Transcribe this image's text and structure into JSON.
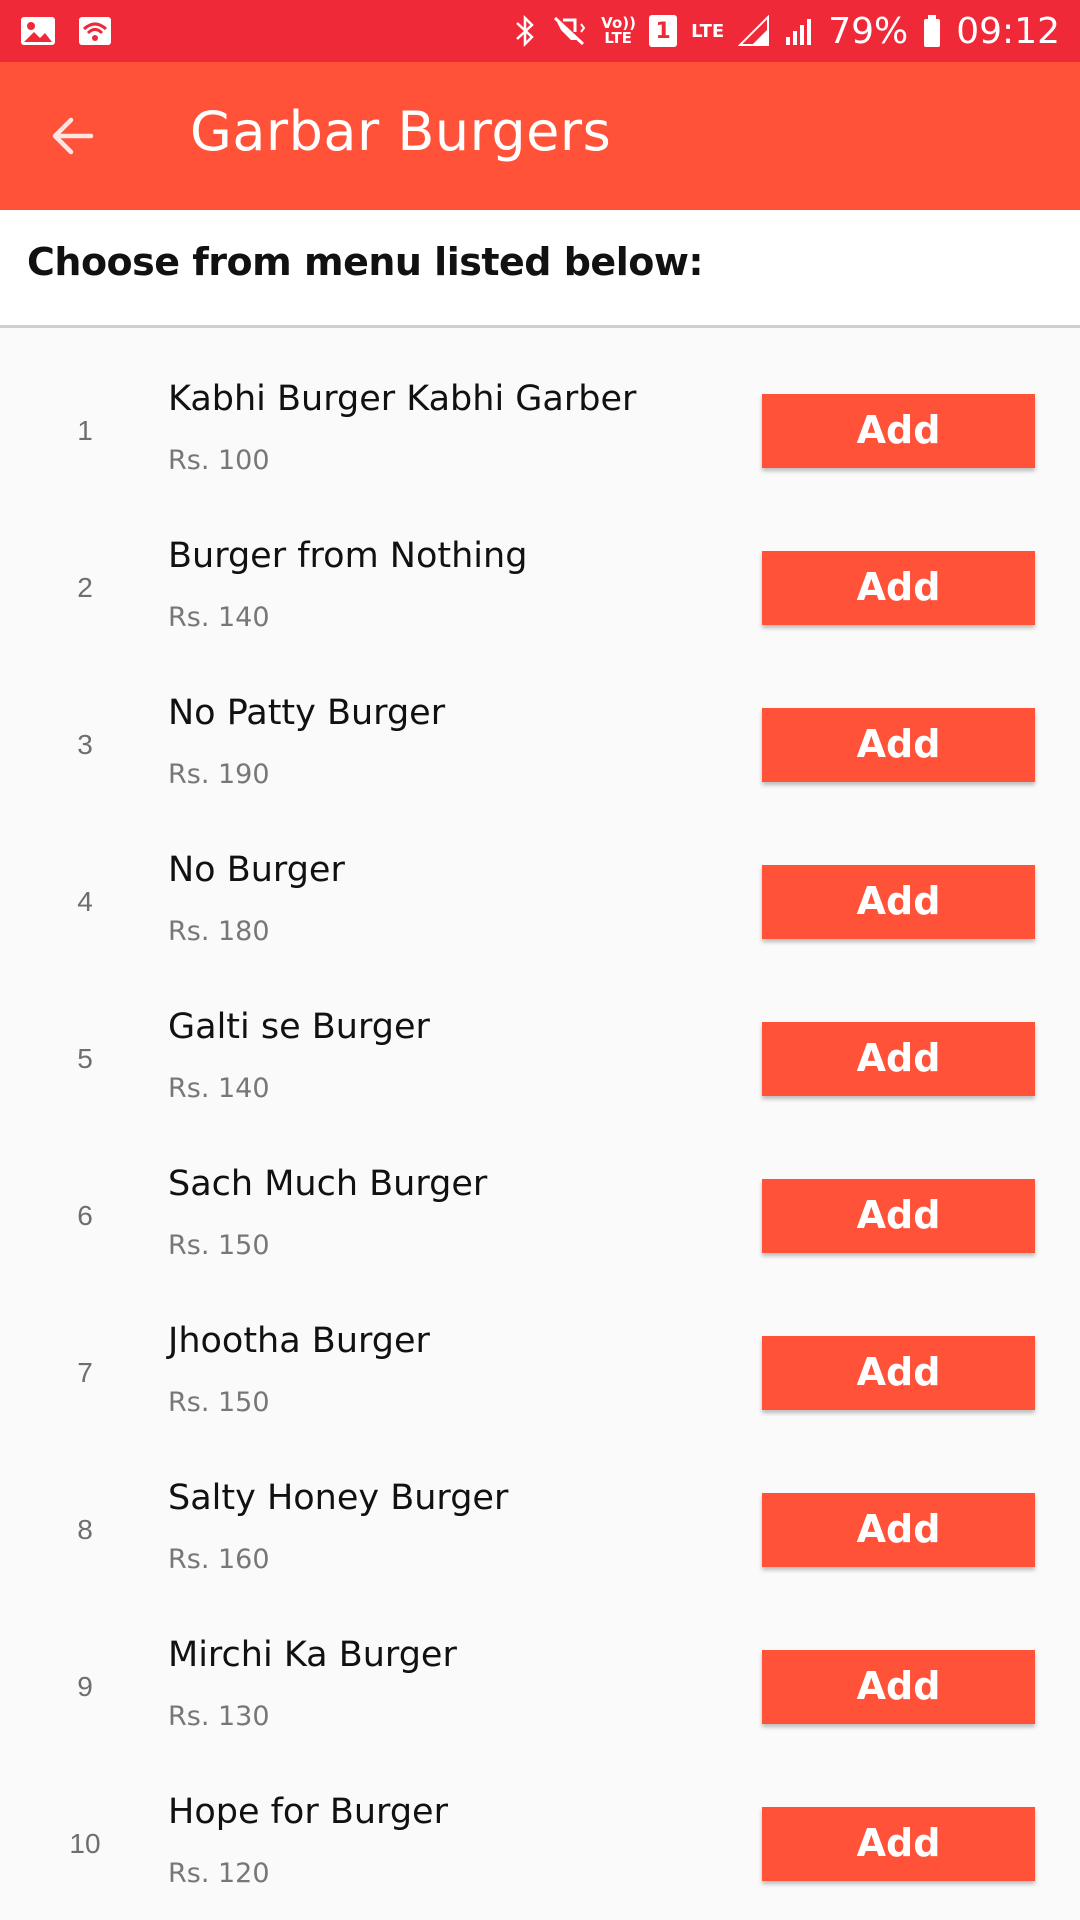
{
  "status_bar": {
    "left_icons": [
      "image-icon",
      "wifi-hotspot-icon"
    ],
    "volte_label": "Vo)) LTE",
    "sim_label": "1",
    "lte_label": "LTE",
    "battery_percent": "79%",
    "time": "09:12"
  },
  "app_bar": {
    "title": "Garbar Burgers"
  },
  "header": {
    "text": "Choose from menu listed below:"
  },
  "menu": {
    "add_label": "Add",
    "items": [
      {
        "index": "1",
        "name": "Kabhi Burger Kabhi Garber",
        "price": "Rs. 100"
      },
      {
        "index": "2",
        "name": "Burger from Nothing",
        "price": "Rs. 140"
      },
      {
        "index": "3",
        "name": "No Patty Burger",
        "price": "Rs. 190"
      },
      {
        "index": "4",
        "name": "No Burger",
        "price": "Rs. 180"
      },
      {
        "index": "5",
        "name": "Galti se Burger",
        "price": "Rs. 140"
      },
      {
        "index": "6",
        "name": "Sach Much Burger",
        "price": "Rs. 150"
      },
      {
        "index": "7",
        "name": "Jhootha Burger",
        "price": "Rs. 150"
      },
      {
        "index": "8",
        "name": "Salty Honey Burger",
        "price": "Rs. 160"
      },
      {
        "index": "9",
        "name": "Mirchi Ka Burger",
        "price": "Rs. 130"
      },
      {
        "index": "10",
        "name": "Hope for Burger",
        "price": "Rs. 120"
      }
    ]
  },
  "colors": {
    "status_bar": "#ef2938",
    "app_bar": "#ff5238",
    "add_button": "#ff5238"
  }
}
